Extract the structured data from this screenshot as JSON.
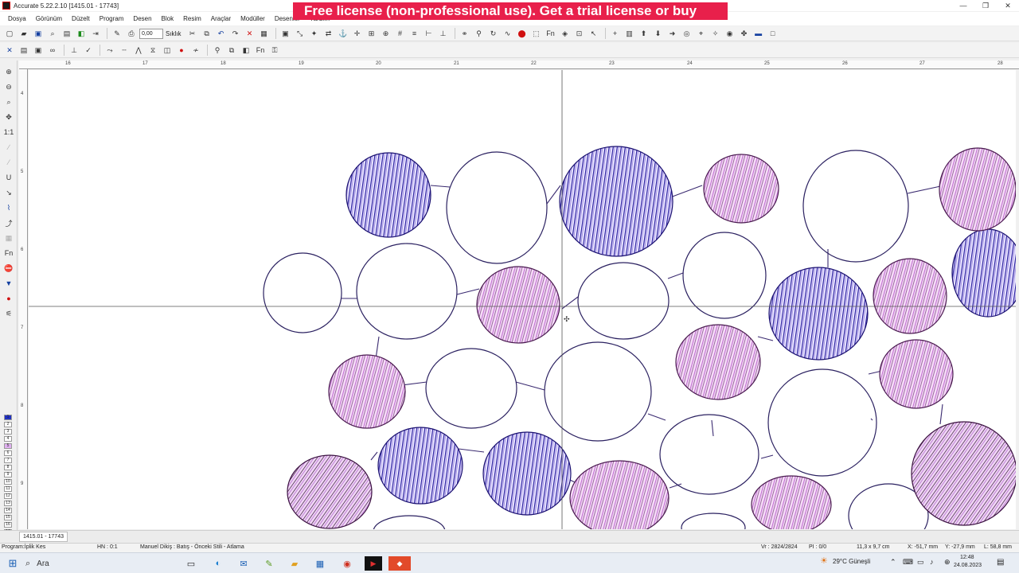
{
  "window": {
    "title": "Accurate 5.22.2.10 [1415.01 - 17743]",
    "controls": [
      "—",
      "❐",
      "✕"
    ]
  },
  "license_banner": "Free license (non-professional use). Get a trial license or buy",
  "menu": [
    "Dosya",
    "Görünüm",
    "Düzelt",
    "Program",
    "Desen",
    "Blok",
    "Resim",
    "Araçlar",
    "Modüller",
    "Desenler",
    "Yardım"
  ],
  "toolbar": {
    "speed_value": "0,00",
    "speed_label": "Sıklık"
  },
  "ruler": {
    "horizontal": [
      "16",
      "17",
      "18",
      "19",
      "20",
      "21",
      "22",
      "23",
      "24",
      "25",
      "26",
      "27",
      "28"
    ],
    "vertical": [
      "4",
      "5",
      "6",
      "7",
      "8",
      "9"
    ]
  },
  "left_tools": [
    "zoom-in",
    "zoom-out",
    "zoom-window",
    "pan",
    "1:1",
    "stitch",
    "stitch",
    "U",
    "arrow",
    "measure",
    "jump",
    "select",
    "Fn",
    "stop",
    "needle",
    "record",
    "tension"
  ],
  "palette": [
    "1",
    "2",
    "3",
    "4",
    "5",
    "6",
    "7",
    "8",
    "9",
    "10",
    "11",
    "12",
    "13",
    "14",
    "15",
    "16",
    "17",
    "18",
    "19",
    "20"
  ],
  "document_tab": "1415.01 - 17743",
  "status": {
    "mode": "Program:İplik Kes",
    "hn": "HN : 0:1",
    "hint": "Manuel Dikiş : Batış - Önceki Stili - Atlama",
    "vr": "Vr : 2824/2824",
    "pi": "PI : 0/0",
    "size": "11,3 x 9,7 cm",
    "x": "X: -51,7 mm",
    "y": "Y: -27,9 mm",
    "l": "L: 58,8 mm"
  },
  "taskbar": {
    "search_placeholder": "Ara",
    "weather": "29°C  Güneşli",
    "time": "12:48",
    "date": "24.08.2023"
  },
  "colors": {
    "banner": "#e8204b",
    "stitch_purple": "#d090e0",
    "stitch_blue": "#2a1fa0",
    "stitch_dark": "#3a1040"
  }
}
